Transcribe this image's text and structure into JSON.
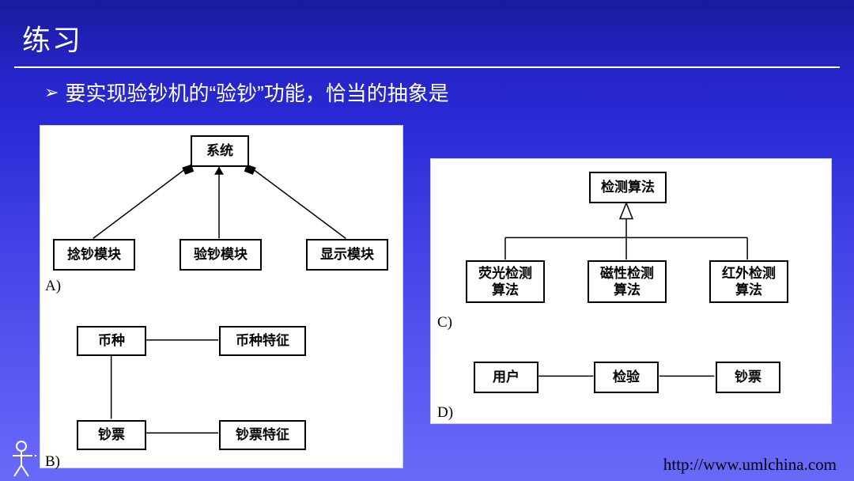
{
  "title": "练习",
  "bullet_text": "要实现验钞机的“验钞”功能，恰当的抽象是",
  "labels": {
    "A": "A)",
    "B": "B)",
    "C": "C)",
    "D": "D)"
  },
  "boxes": {
    "system": "系统",
    "module_money": "捻钞模块",
    "module_verify": "验钞模块",
    "module_display": "显示模块",
    "currency": "币种",
    "currency_feature": "币种特征",
    "banknote": "钞票",
    "banknote_feature": "钞票特征",
    "detect_algo": "检测算法",
    "fluorescent": "荧光检测\n算法",
    "magnetic": "磁性检测\n算法",
    "infrared": "红外检测\n算法",
    "user": "用户",
    "verify": "检验",
    "banknote2": "钞票"
  },
  "footer_url": "http://www.umlchina.com"
}
